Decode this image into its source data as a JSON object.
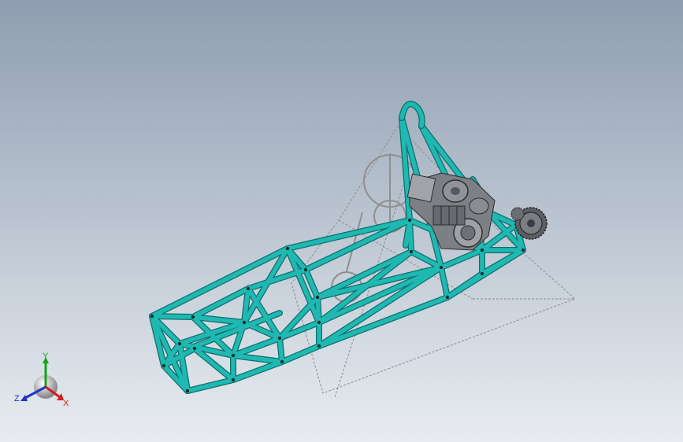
{
  "viewport": {
    "background_top": "#8f9db0",
    "background_bottom": "#e8ecf0"
  },
  "model": {
    "tube_color": "#1fb8b2",
    "tube_edge_color": "#0e6f6b",
    "sketch_color": "#8e8e8e",
    "engine_color": "#7c7f83",
    "sprocket_color": "#5b5e62"
  },
  "triad": {
    "x_label": "X",
    "y_label": "Y",
    "z_label": "Z",
    "x_color": "#d11f1f",
    "y_color": "#16a316",
    "z_color": "#2233cc"
  }
}
